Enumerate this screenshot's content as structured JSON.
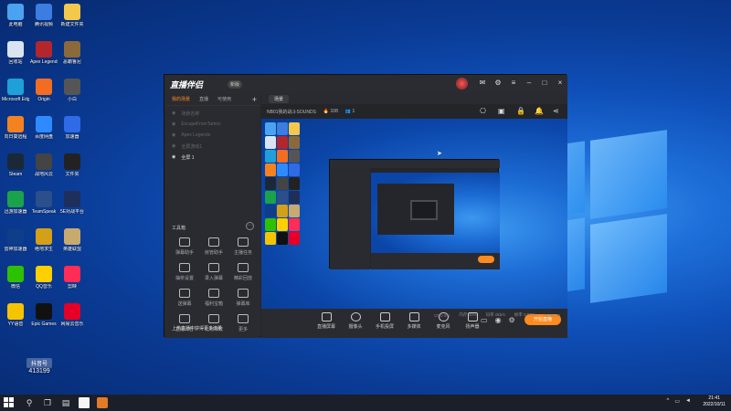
{
  "desktop_icons": [
    {
      "label": "此电脑",
      "color": "#4aa3f0"
    },
    {
      "label": "腾讯视频",
      "color": "#3b7de0"
    },
    {
      "label": "新建文件夹",
      "color": "#f2c94c"
    },
    {
      "label": "回收站",
      "color": "#d8e4f0"
    },
    {
      "label": "Apex Legends",
      "color": "#b3262c"
    },
    {
      "label": "恶霸鲁尼",
      "color": "#8a6a3a"
    },
    {
      "label": "Microsoft Edge",
      "color": "#1fa0d8"
    },
    {
      "label": "Origin",
      "color": "#f26d21"
    },
    {
      "label": "小白",
      "color": "#555555"
    },
    {
      "label": "向日葵远程",
      "color": "#f58220"
    },
    {
      "label": "百度网盘",
      "color": "#2e8bff"
    },
    {
      "label": "加速器",
      "color": "#2f6be6"
    },
    {
      "label": "Steam",
      "color": "#1b2838"
    },
    {
      "label": "战地风云",
      "color": "#444444"
    },
    {
      "label": "文件夹",
      "color": "#222222"
    },
    {
      "label": "迅游加速器",
      "color": "#1aa34a"
    },
    {
      "label": "TeamSpeak",
      "color": "#2b4f8a"
    },
    {
      "label": "5E对战平台",
      "color": "#1d2f5a"
    },
    {
      "label": "雷神加速器",
      "color": "#0e3d8a"
    },
    {
      "label": "绝地求生",
      "color": "#d4a017"
    },
    {
      "label": "英雄联盟",
      "color": "#c8aa6e"
    },
    {
      "label": "微信",
      "color": "#2dc100"
    },
    {
      "label": "QQ音乐",
      "color": "#ffcf00"
    },
    {
      "label": "剪映",
      "color": "#ff2d55"
    },
    {
      "label": "YY语音",
      "color": "#f5c400"
    },
    {
      "label": "Epic Games",
      "color": "#111111"
    },
    {
      "label": "网易云音乐",
      "color": "#e60026"
    }
  ],
  "app": {
    "brand": "直播伴侣",
    "version": "新版",
    "left_tabs": [
      "我的场景",
      "直播",
      "可使用"
    ],
    "scenes": [
      "场景名称",
      "EscapeFromTarkov",
      "Apex Legends",
      "全屏游戏1",
      "全屏 1"
    ],
    "tools_title": "工具箱",
    "tools_more": "···",
    "tools": [
      "弹幕助手",
      "房管助手",
      "主播任务",
      "抽奖设置",
      "录入弹幕",
      "精彩回放",
      "送弹幕",
      "福利宝箱",
      "弹幕库",
      "直播公告",
      "礼物特效",
      "更多"
    ],
    "bottom_notice": "上热直播中获得更多流量",
    "main_tab": "场景",
    "stream_title": "NB01我的战斗SOUNDS",
    "viewers": "108",
    "fans": "1",
    "controls": [
      "直播屏幕",
      "摄像头",
      "手机投屏",
      "多媒体",
      "麦克风",
      "扬声器"
    ],
    "go_live": "开始直播",
    "status": [
      "CPU 0%",
      "内存 40%",
      "码率 0kb/s",
      "帧率 0 FPS",
      "00:00:00"
    ]
  },
  "taskbar": {
    "time": "21:41",
    "date": "2022/10/11"
  },
  "watermark": {
    "title": "抖音号",
    "id": "413199"
  }
}
